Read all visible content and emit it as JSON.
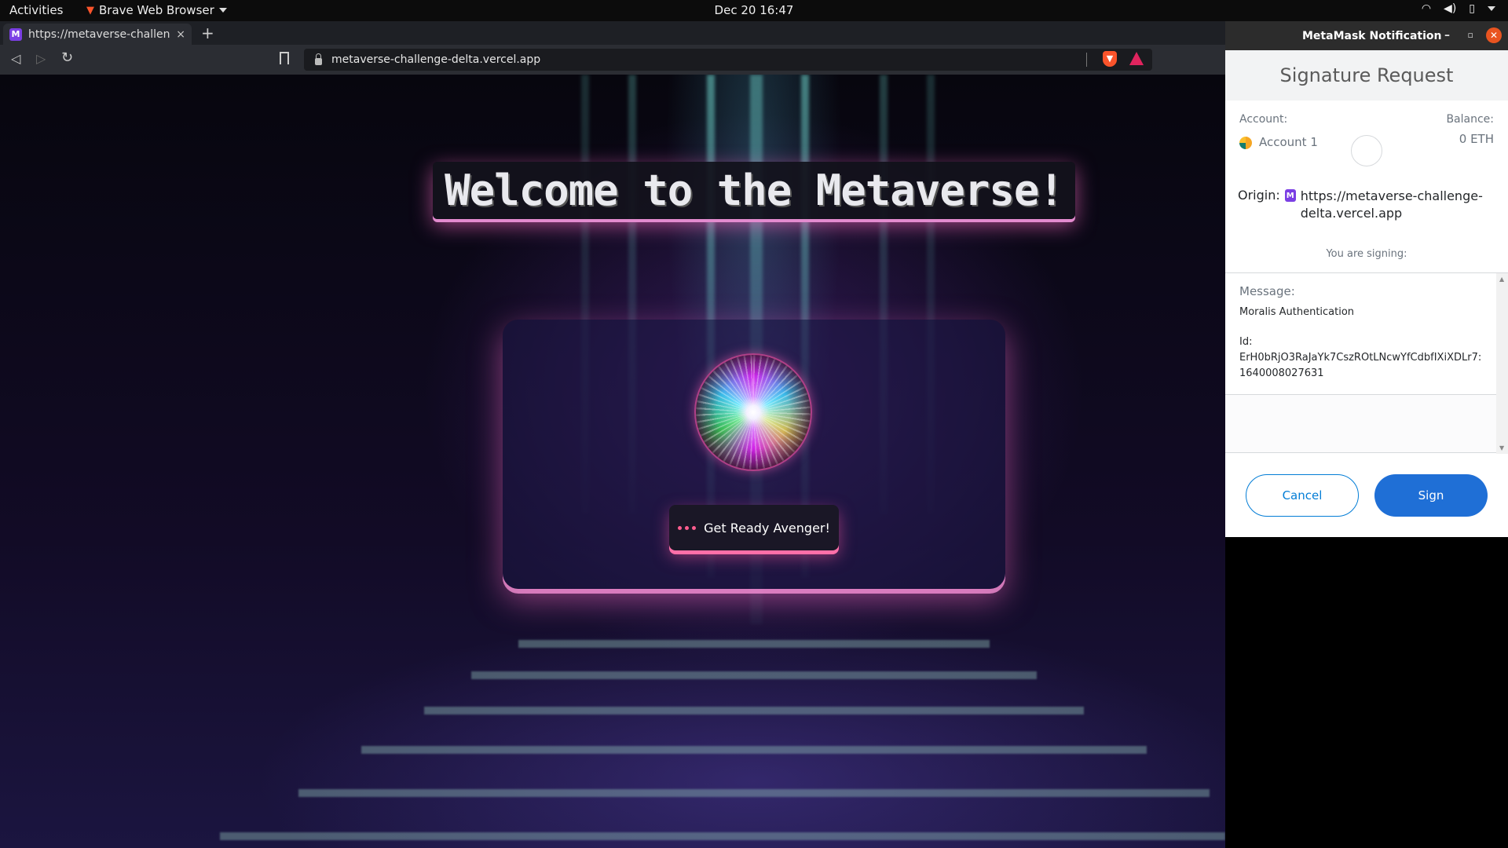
{
  "system": {
    "activities": "Activities",
    "app_name": "Brave Web Browser",
    "clock": "Dec 20  16:47"
  },
  "browser": {
    "tab_title": "https://metaverse-challen",
    "tab_close": "×",
    "new_tab": "+",
    "url": "metaverse-challenge-delta.vercel.app"
  },
  "page": {
    "heading": "Welcome to the Metaverse!",
    "button_label": "Get Ready Avenger!"
  },
  "metamask": {
    "window_title": "MetaMask Notification",
    "header": "Signature Request",
    "account_label": "Account:",
    "account_name": "Account 1",
    "balance_label": "Balance:",
    "balance_value": "0 ETH",
    "origin_label": "Origin:",
    "origin_url": "https://metaverse-challenge-delta.vercel.app",
    "signing_label": "You are signing:",
    "message_label": "Message:",
    "message_text": "Moralis Authentication",
    "id_label": "Id:",
    "id_value": "ErH0bRjO3RaJaYk7CszROtLNcwYfCdbfIXiXDLr7:1640008027631",
    "cancel_label": "Cancel",
    "sign_label": "Sign"
  }
}
